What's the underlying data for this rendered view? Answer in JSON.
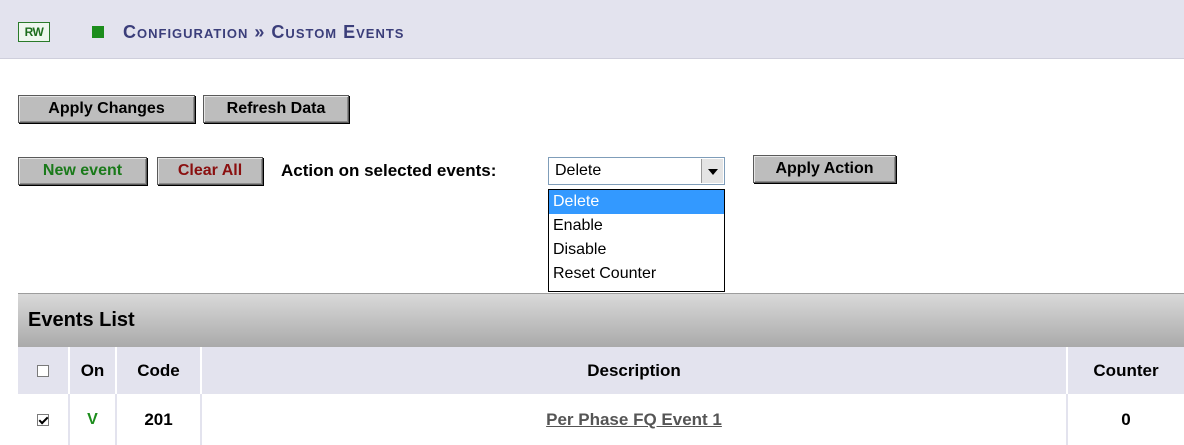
{
  "header": {
    "rw_badge": "RW",
    "title": "Configuration » Custom Events"
  },
  "toolbar": {
    "apply_changes": "Apply Changes",
    "refresh_data": "Refresh Data",
    "new_event": "New event",
    "clear_all": "Clear All",
    "action_label": "Action on selected events:",
    "action_select": {
      "selected": "Delete",
      "options": [
        "Delete",
        "Enable",
        "Disable",
        "Reset Counter"
      ]
    },
    "apply_action": "Apply Action"
  },
  "events_list": {
    "title": "Events List",
    "columns": {
      "on": "On",
      "code": "Code",
      "description": "Description",
      "counter": "Counter"
    },
    "rows": [
      {
        "checked": true,
        "on": "V",
        "code": "201",
        "description": "Per Phase FQ Event 1",
        "counter": "0"
      }
    ]
  }
}
